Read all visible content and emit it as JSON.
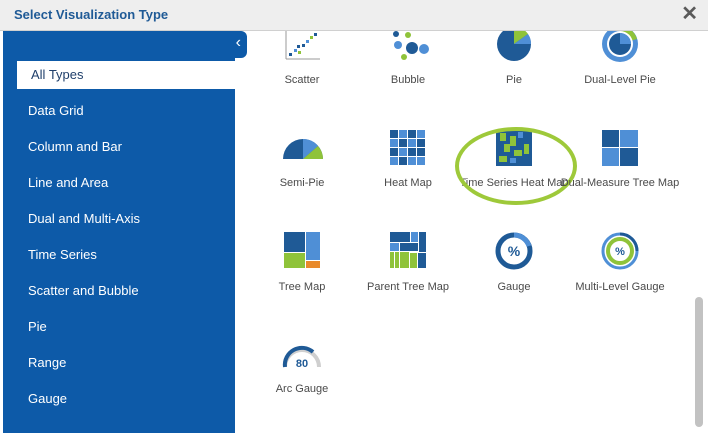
{
  "dialog": {
    "title": "Select Visualization Type",
    "close_label": "✕"
  },
  "sidebar": {
    "collapse_icon": "‹",
    "items": [
      {
        "label": "All Types",
        "active": true
      },
      {
        "label": "Data Grid"
      },
      {
        "label": "Column and Bar"
      },
      {
        "label": "Line and Area"
      },
      {
        "label": "Dual and Multi-Axis"
      },
      {
        "label": "Time Series"
      },
      {
        "label": "Scatter and Bubble"
      },
      {
        "label": "Pie"
      },
      {
        "label": "Range"
      },
      {
        "label": "Gauge"
      }
    ]
  },
  "tiles": [
    {
      "label": "Scatter",
      "icon": "scatter-chart-icon"
    },
    {
      "label": "Bubble",
      "icon": "bubble-chart-icon"
    },
    {
      "label": "Pie",
      "icon": "pie-chart-icon"
    },
    {
      "label": "Dual-Level Pie",
      "icon": "dual-level-pie-icon"
    },
    {
      "label": "Semi-Pie",
      "icon": "semi-pie-icon"
    },
    {
      "label": "Heat Map",
      "icon": "heat-map-icon"
    },
    {
      "label": "Time Series Heat Map",
      "icon": "time-series-heat-map-icon"
    },
    {
      "label": "Dual-Measure Tree Map",
      "icon": "dual-measure-tree-map-icon"
    },
    {
      "label": "Tree Map",
      "icon": "tree-map-icon"
    },
    {
      "label": "Parent Tree Map",
      "icon": "parent-tree-map-icon"
    },
    {
      "label": "Gauge",
      "icon": "gauge-icon",
      "glyph": "%"
    },
    {
      "label": "Multi-Level Gauge",
      "icon": "multi-level-gauge-icon",
      "glyph": "%"
    },
    {
      "label": "Arc Gauge",
      "icon": "arc-gauge-icon",
      "glyph": "80"
    }
  ],
  "colors": {
    "brand_blue": "#0d5aa8",
    "dark_blue": "#1f5a96",
    "light_blue": "#4f8fd6",
    "green": "#8fc33a",
    "highlight": "#9ec93a"
  }
}
